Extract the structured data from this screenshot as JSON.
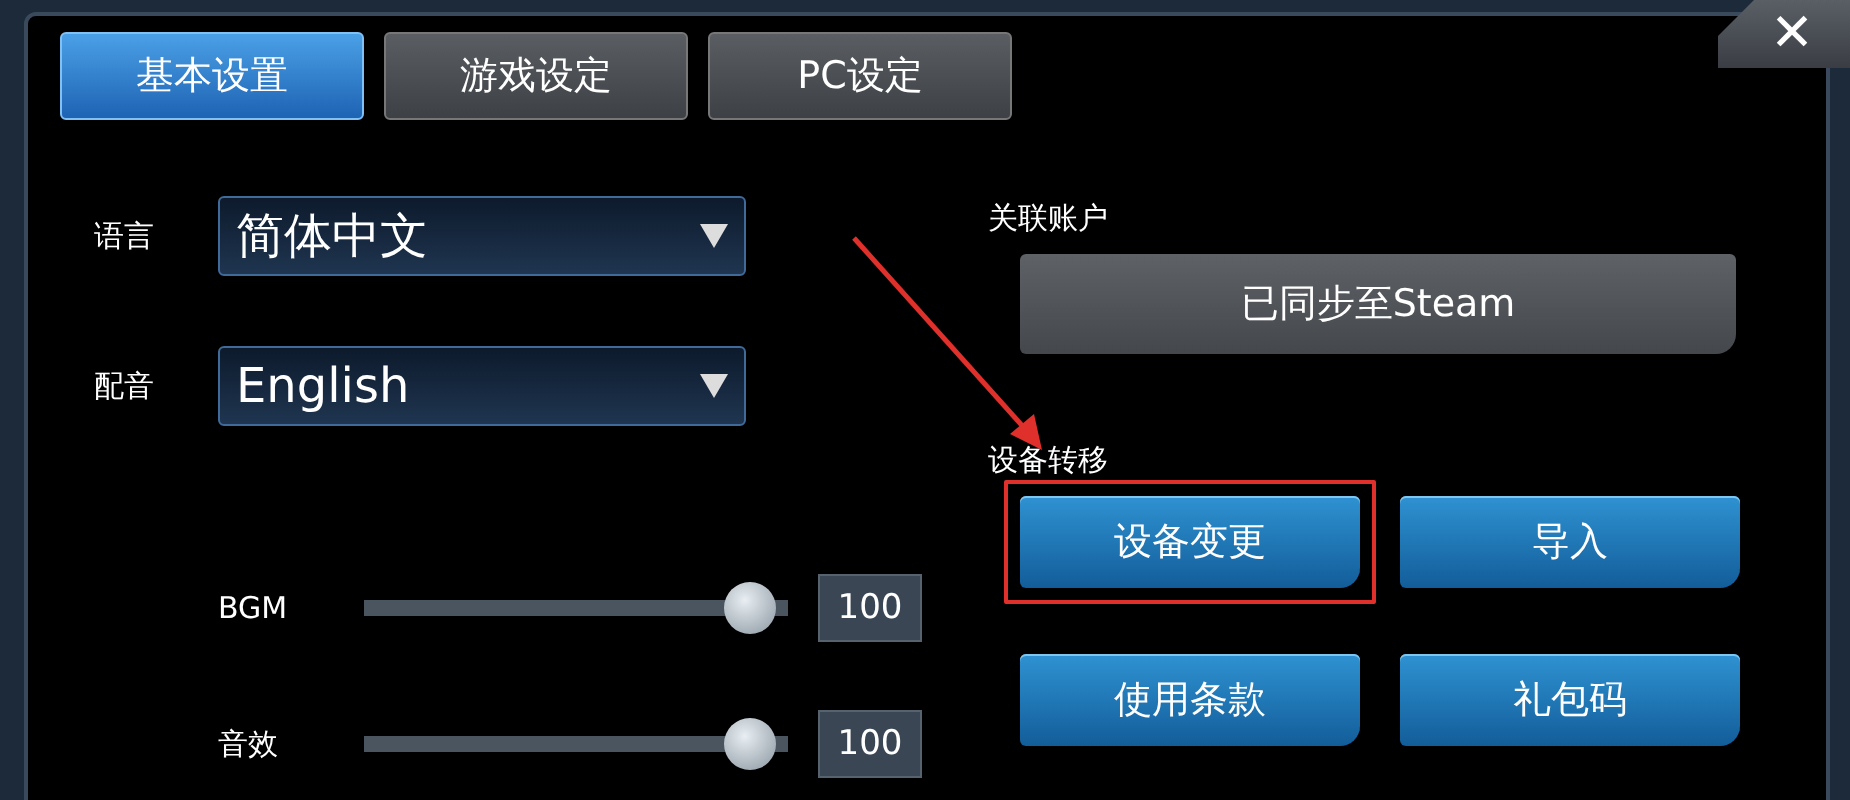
{
  "close_button": {
    "label": "✕"
  },
  "tabs": [
    {
      "label": "基本设置",
      "selected": true
    },
    {
      "label": "游戏设定",
      "selected": false
    },
    {
      "label": "PC设定",
      "selected": false
    }
  ],
  "dropdowns": [
    {
      "label": "语言",
      "value": "简体中文"
    },
    {
      "label": "配音",
      "value": "English"
    }
  ],
  "sliders": [
    {
      "label": "BGM",
      "level": 0.97,
      "reading": "100"
    },
    {
      "label": "音效",
      "level": 0.97,
      "reading": "100"
    }
  ],
  "account": {
    "label": "关联账户",
    "button": "已同步至Steam"
  },
  "transfer": {
    "label": "设备转移"
  },
  "buttons": [
    {
      "label": "设备变更",
      "highlighted": true
    },
    {
      "label": "导入",
      "highlighted": false
    },
    {
      "label": "使用条款",
      "highlighted": false
    },
    {
      "label": "礼包码",
      "highlighted": false
    }
  ],
  "annotation_arrow": true
}
